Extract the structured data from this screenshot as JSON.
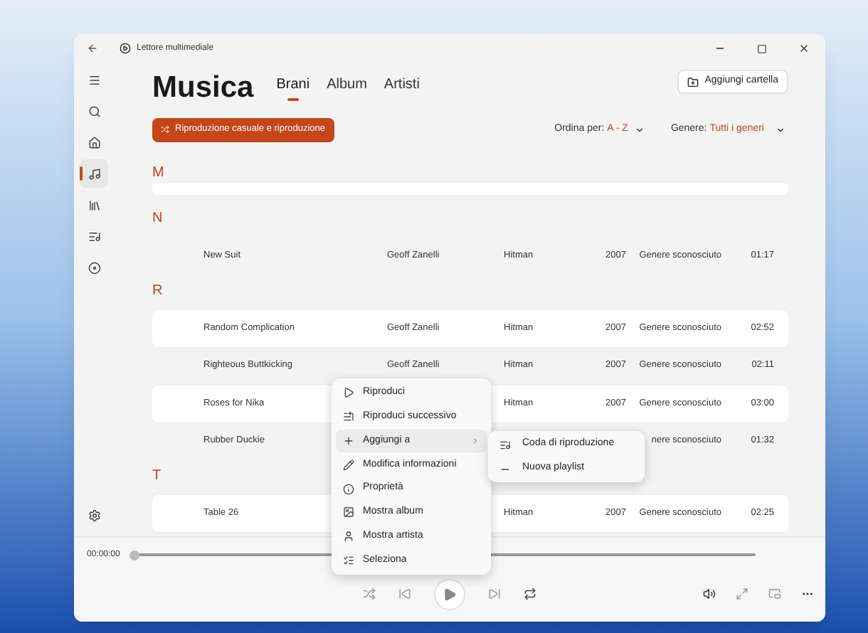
{
  "window": {
    "title": "Lettore multimediale"
  },
  "sidebar": {
    "items": [
      {
        "selected": false
      },
      {
        "selected": false
      },
      {
        "selected": false
      },
      {
        "selected": true
      },
      {
        "selected": false
      },
      {
        "selected": false
      },
      {
        "selected": false
      }
    ]
  },
  "header": {
    "title": "Musica",
    "add_folder_button": "Aggiungi cartella"
  },
  "tabs": [
    {
      "label": "Brani",
      "selected": true
    },
    {
      "label": "Album",
      "selected": false
    },
    {
      "label": "Artisti",
      "selected": false
    }
  ],
  "shuffle_button": "Riproduzione casuale e riproduzione",
  "sort": {
    "label": "Ordina per:",
    "value": "A - Z"
  },
  "genre_filter": {
    "label": "Genere:",
    "value": "Tutti i generi"
  },
  "sections": [
    {
      "letter": "M",
      "cut_off": true
    },
    {
      "letter": "N",
      "rows": [
        {
          "title": "New Suit",
          "artist": "Geoff Zanelli",
          "album": "Hitman",
          "year": "2007",
          "genre": "Genere sconosciuto",
          "duration": "01:17",
          "shaded": false
        }
      ]
    },
    {
      "letter": "R",
      "rows": [
        {
          "title": "Random Complication",
          "artist": "Geoff Zanelli",
          "album": "Hitman",
          "year": "2007",
          "genre": "Genere sconosciuto",
          "duration": "02:52",
          "shaded": true
        },
        {
          "title": "Righteous Buttkicking",
          "artist": "Geoff Zanelli",
          "album": "Hitman",
          "year": "2007",
          "genre": "Genere sconosciuto",
          "duration": "02:11",
          "shaded": false
        },
        {
          "title": "Roses for Nika",
          "album": "Hitman",
          "year": "2007",
          "genre": "Genere sconosciuto",
          "duration": "03:00",
          "shaded": true
        },
        {
          "title": "Rubber Duckie",
          "genre": "nere sconosciuto",
          "duration": "01:32",
          "shaded": false
        }
      ]
    },
    {
      "letter": "T",
      "rows": [
        {
          "title": "Table 26",
          "album": "Hitman",
          "year": "2007",
          "genre": "Genere sconosciuto",
          "duration": "02:25",
          "shaded": true
        }
      ]
    }
  ],
  "context_menu": {
    "items": [
      {
        "label": "Riproduci",
        "selected": false,
        "has_submenu": false
      },
      {
        "label": "Riproduci successivo",
        "selected": false,
        "has_submenu": false
      },
      {
        "label": "Aggiungi a",
        "selected": true,
        "has_submenu": true
      },
      {
        "label": "Modifica informazioni",
        "selected": false,
        "has_submenu": false
      },
      {
        "label": "Proprietà",
        "selected": false,
        "has_submenu": false
      },
      {
        "label": "Mostra album",
        "selected": false,
        "has_submenu": false
      },
      {
        "label": "Mostra artista",
        "selected": false,
        "has_submenu": false
      },
      {
        "label": "Seleziona",
        "selected": false,
        "has_submenu": false
      }
    ]
  },
  "submenu": {
    "items": [
      {
        "label": "Coda di riproduzione"
      },
      {
        "label": "Nuova playlist"
      }
    ]
  },
  "player": {
    "time": "00:00:00",
    "level": 0
  }
}
